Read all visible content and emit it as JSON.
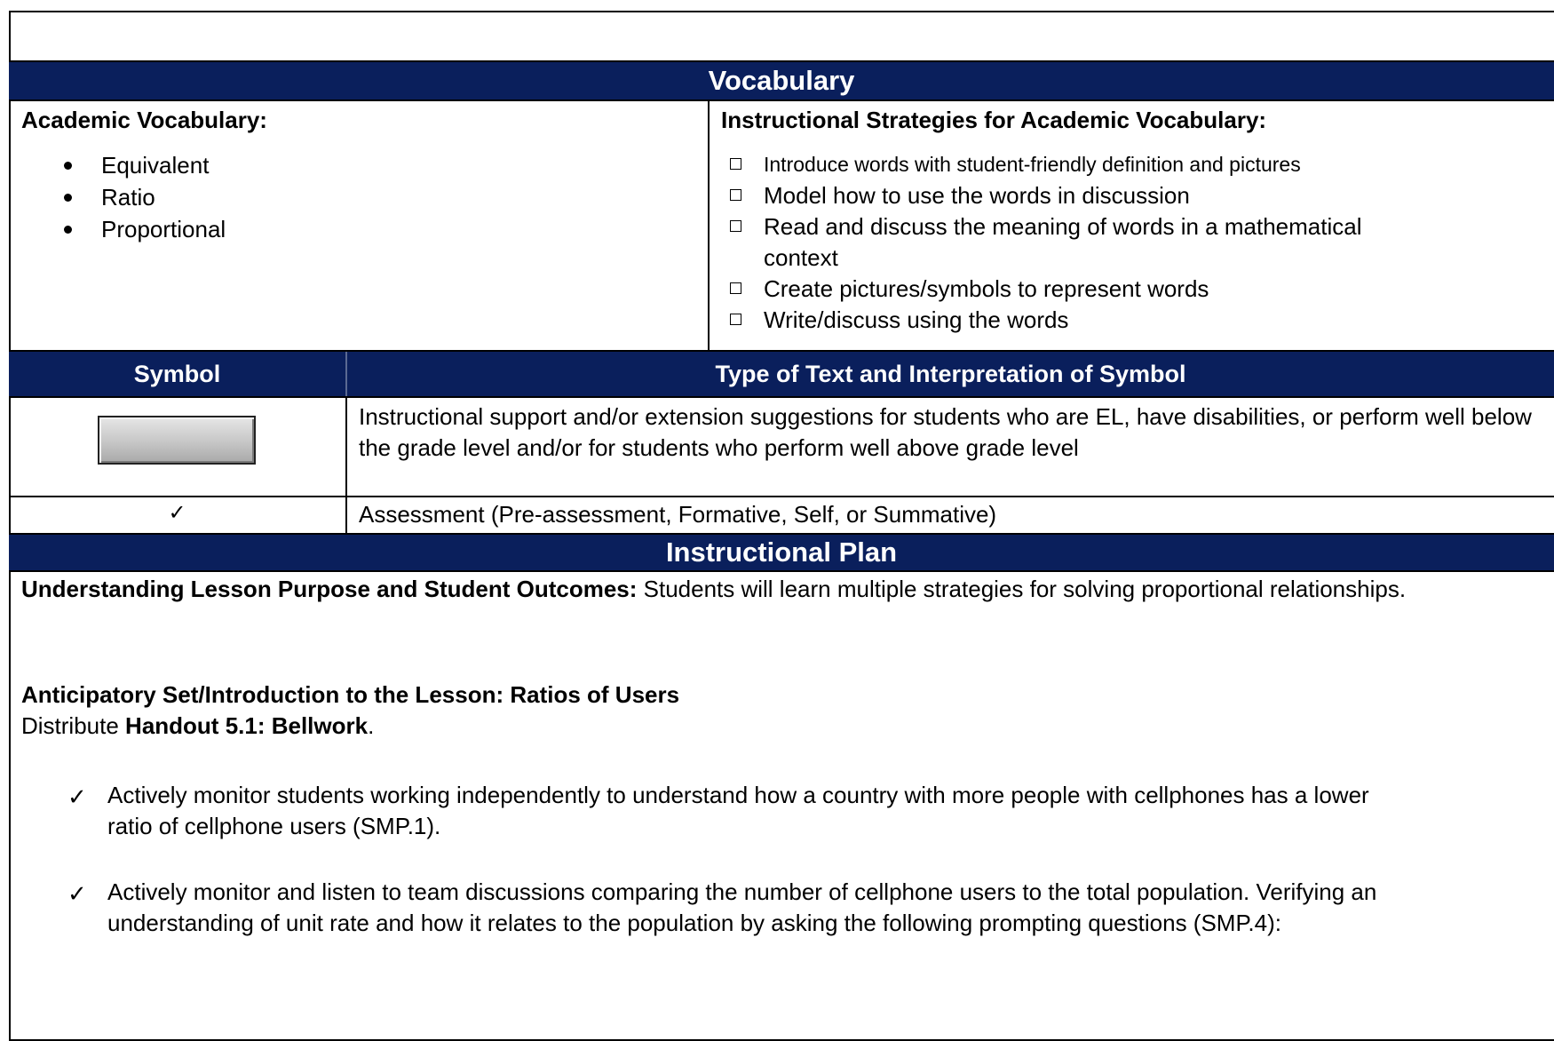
{
  "vocabulary": {
    "heading": "Vocabulary",
    "academic_label": "Academic Vocabulary:",
    "words": [
      "Equivalent",
      "Ratio",
      "Proportional"
    ],
    "strategies_label": "Instructional Strategies for Academic Vocabulary:",
    "strategies": [
      "Introduce words with student-friendly definition and pictures",
      "Model how to use the words in discussion",
      "Read and discuss the meaning of words in a mathematical context",
      "Create pictures/symbols to represent words",
      "Write/discuss using the words"
    ]
  },
  "symbols": {
    "col1": "Symbol",
    "col2": "Type of Text and Interpretation of Symbol",
    "rows": [
      {
        "symbol": "gray-button-icon",
        "text": "Instructional support and/or extension suggestions for students who are EL, have disabilities, or perform well below the grade level and/or for students who perform well above grade level"
      },
      {
        "symbol": "✓",
        "text": "Assessment (Pre-assessment, Formative, Self, or Summative)"
      }
    ]
  },
  "plan": {
    "heading": "Instructional Plan",
    "purpose_label": "Understanding Lesson Purpose and Student Outcomes:",
    "purpose_text": " Students will learn multiple strategies for solving proportional relationships.",
    "anticipatory_label": "Anticipatory Set/Introduction to the Lesson: Ratios of Users",
    "distribute_prefix": "Distribute ",
    "handout": "Handout 5.1: Bellwork",
    "distribute_suffix": ".",
    "checks": [
      "Actively monitor students working independently to understand how a country with more people with cellphones has a lower ratio of cellphone users (SMP.1).",
      "Actively monitor and listen to team discussions comparing the number of cellphone users to the total population. Verifying an understanding of unit rate and how it relates to the population by asking the following prompting questions (SMP.4):"
    ],
    "check_glyph": "✓"
  }
}
